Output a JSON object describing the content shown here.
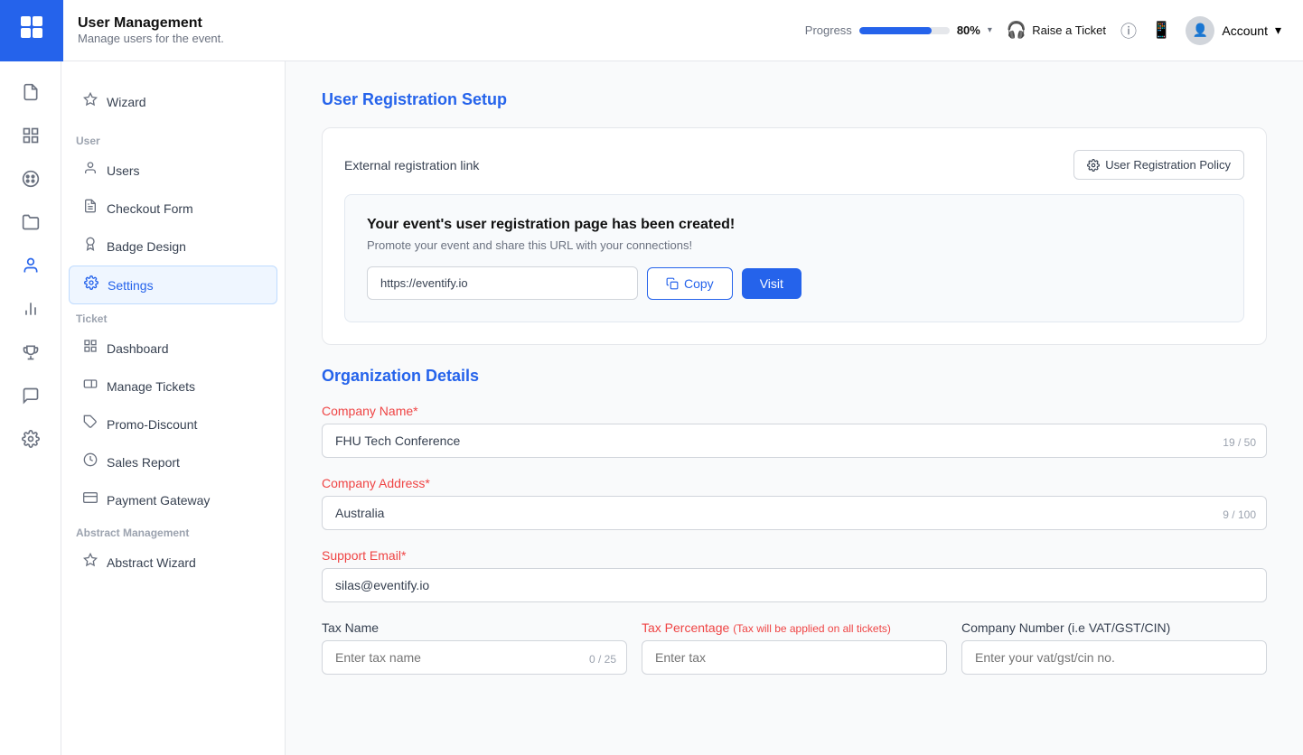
{
  "topbar": {
    "logo_text": "≡",
    "title": "User Management",
    "subtitle": "Manage users for the event.",
    "progress_label": "Progress",
    "progress_value": 80,
    "progress_text": "80%",
    "raise_ticket_label": "Raise a Ticket",
    "account_label": "Account"
  },
  "sidebar_icons": [
    {
      "name": "file-icon",
      "symbol": "🗋",
      "active": false
    },
    {
      "name": "grid-icon",
      "symbol": "⊞",
      "active": false
    },
    {
      "name": "palette-icon",
      "symbol": "🎨",
      "active": false
    },
    {
      "name": "folder-icon",
      "symbol": "📁",
      "active": false
    },
    {
      "name": "user-icon",
      "symbol": "👤",
      "active": true
    },
    {
      "name": "chart-icon",
      "symbol": "📊",
      "active": false
    },
    {
      "name": "trophy-icon",
      "symbol": "🏆",
      "active": false
    },
    {
      "name": "chat-icon",
      "symbol": "💬",
      "active": false
    },
    {
      "name": "settings-icon",
      "symbol": "⚙",
      "active": false
    }
  ],
  "secondary_sidebar": {
    "wizard_label": "Wizard",
    "user_section": "User",
    "user_items": [
      {
        "label": "Users",
        "icon": "👤"
      },
      {
        "label": "Checkout Form",
        "icon": "📄"
      },
      {
        "label": "Badge Design",
        "icon": "🏅"
      },
      {
        "label": "Settings",
        "icon": "⚙",
        "active": true
      }
    ],
    "ticket_section": "Ticket",
    "ticket_items": [
      {
        "label": "Dashboard",
        "icon": "🖥"
      },
      {
        "label": "Manage Tickets",
        "icon": "🎫"
      },
      {
        "label": "Promo-Discount",
        "icon": "🏷"
      },
      {
        "label": "Sales Report",
        "icon": "⏱"
      },
      {
        "label": "Payment Gateway",
        "icon": "💳"
      }
    ],
    "abstract_section": "Abstract Management",
    "abstract_items": [
      {
        "label": "Abstract Wizard",
        "icon": "⚡"
      }
    ]
  },
  "main": {
    "page_title": "User Registration Setup",
    "external_link_label": "External registration link",
    "policy_btn_label": "User Registration Policy",
    "registration_card": {
      "title": "Your event's user registration page has been created!",
      "subtitle": "Promote your event and share this URL with your connections!",
      "url": "https://eventify.io",
      "copy_label": "Copy",
      "visit_label": "Visit"
    },
    "org_section_title": "Organization Details",
    "company_name_label": "Company Name",
    "company_name_value": "FHU Tech Conference",
    "company_name_count": "19 / 50",
    "company_address_label": "Company Address",
    "company_address_value": "Australia",
    "company_address_count": "9 / 100",
    "support_email_label": "Support Email",
    "support_email_value": "silas@eventify.io",
    "tax_name_label": "Tax Name",
    "tax_name_placeholder": "Enter tax name",
    "tax_name_count": "0 / 25",
    "tax_percentage_label": "Tax Percentage",
    "tax_percentage_sub": "(Tax will be applied on all tickets)",
    "tax_percentage_placeholder": "Enter tax",
    "company_number_label": "Company Number (i.e VAT/GST/CIN)",
    "company_number_placeholder": "Enter your vat/gst/cin no."
  }
}
